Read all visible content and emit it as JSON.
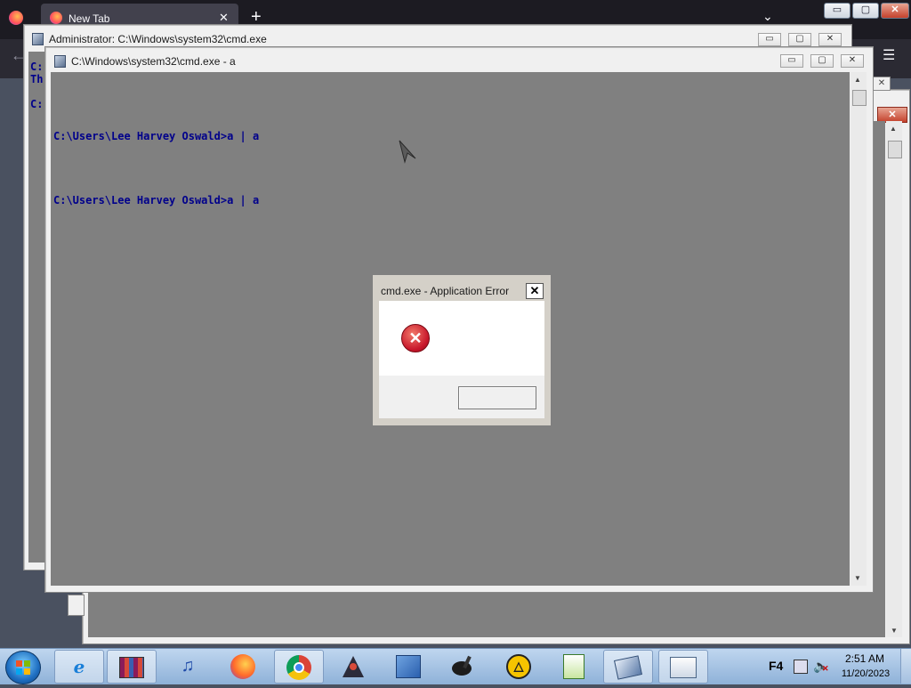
{
  "browser": {
    "tab_title": "New Tab",
    "tab_close": "✕",
    "new_tab": "+",
    "list_tabs": "⌄",
    "back": "←",
    "menu": "☰"
  },
  "window_admin": {
    "title": "Administrator: C:\\Windows\\system32\\cmd.exe",
    "lines": [
      "C:",
      "Th",
      "",
      "C:"
    ]
  },
  "window_front": {
    "title": "C:\\Windows\\system32\\cmd.exe - a",
    "console_lines": [
      "C:\\Users\\Lee Harvey Oswald>a | a",
      "C:\\Users\\Lee Harvey Oswald>a | a"
    ]
  },
  "dialog": {
    "title": "cmd.exe - Application Error",
    "close": "✕",
    "ok_label": ""
  },
  "controls": {
    "min": "▭",
    "max": "▢",
    "close": "✕",
    "up": "▲",
    "down": "▼"
  },
  "taskbar": {
    "items": [
      {
        "name": "Internet Explorer",
        "icon": "ie-icon"
      },
      {
        "name": "WinRAR",
        "icon": "winrar-icon"
      },
      {
        "name": "iTunes",
        "icon": "itunes-icon"
      },
      {
        "name": "Firefox",
        "icon": "firefox-icon"
      },
      {
        "name": "Chrome",
        "icon": "chrome-icon"
      },
      {
        "name": "Java",
        "icon": "java-icon"
      },
      {
        "name": "Quartus",
        "icon": "quartus-icon"
      },
      {
        "name": "Paint",
        "icon": "paint-icon"
      },
      {
        "name": "AIMP",
        "icon": "aimp-icon"
      },
      {
        "name": "Gnuplot",
        "icon": "gnuplot-icon"
      },
      {
        "name": "Command Prompt",
        "icon": "cmd-icon"
      },
      {
        "name": "Explorer",
        "icon": "explorer-icon"
      }
    ],
    "tray_f4": "F4",
    "time": "2:51 AM",
    "date": "11/20/2023"
  },
  "colors": {
    "console_bg": "#808080",
    "console_text": "#00008b",
    "taskbar": "#9dbde2",
    "error_red": "#c8172b"
  }
}
